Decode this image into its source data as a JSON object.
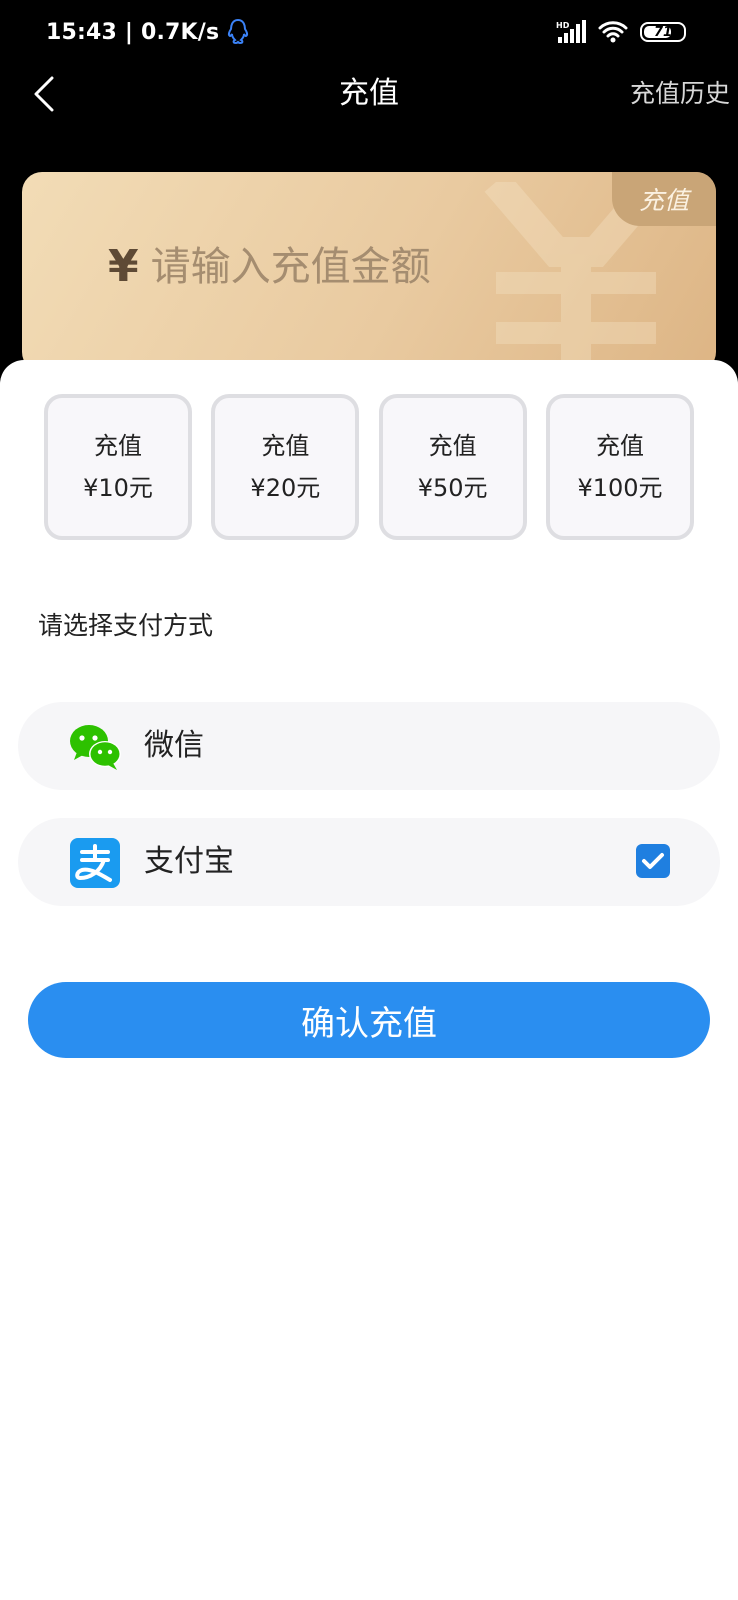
{
  "status_bar": {
    "time_speed": "15:43 | 0.7K/s",
    "network_label": "HD",
    "battery": "71",
    "battery_level_percent": 71
  },
  "nav": {
    "title": "充值",
    "history_link": "充值历史"
  },
  "amount_card": {
    "tab_label": "充值",
    "currency_symbol": "¥",
    "input_placeholder": "请输入充值金额",
    "input_value": ""
  },
  "presets": [
    {
      "line1": "充值",
      "line2": "¥10元"
    },
    {
      "line1": "充值",
      "line2": "¥20元"
    },
    {
      "line1": "充值",
      "line2": "¥50元"
    },
    {
      "line1": "充值",
      "line2": "¥100元"
    }
  ],
  "payment": {
    "prompt": "请选择支付方式",
    "methods": [
      {
        "label": "微信",
        "icon": "wechat-icon",
        "selected": false
      },
      {
        "label": "支付宝",
        "icon": "alipay-icon",
        "selected": true
      }
    ]
  },
  "confirm_button": "确认充值",
  "colors": {
    "accent": "#2a8ef0",
    "checkbox": "#1f7fe0",
    "wechat_green": "#2dc100",
    "alipay_blue": "#1a9bf0",
    "card_gold": "#e9caa0"
  }
}
